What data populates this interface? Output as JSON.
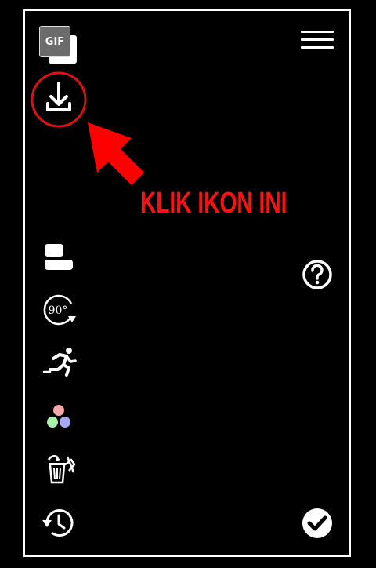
{
  "header": {
    "gif_badge": {
      "label": "GIF",
      "icon": "gif-icon"
    },
    "menu": {
      "icon": "hamburger-menu-icon"
    }
  },
  "primary_action": {
    "icon": "download-icon",
    "highlight_color": "#e01010"
  },
  "annotation": {
    "text": "KLIK IKON INI",
    "color": "#ff1010",
    "arrow_icon": "arrow-pointer-icon"
  },
  "toolbar": [
    {
      "name": "layout",
      "icon": "layout-blocks-icon"
    },
    {
      "name": "rotate",
      "icon": "rotate-90-icon",
      "label": "90°"
    },
    {
      "name": "speed",
      "icon": "running-person-icon"
    },
    {
      "name": "color",
      "icon": "color-circles-icon"
    },
    {
      "name": "delete",
      "icon": "trash-icon"
    },
    {
      "name": "history",
      "icon": "history-icon"
    }
  ],
  "help": {
    "icon": "help-icon"
  },
  "confirm": {
    "icon": "checkmark-icon"
  },
  "colors": {
    "background": "#000000",
    "foreground": "#ffffff",
    "accent": "#ff1010"
  }
}
